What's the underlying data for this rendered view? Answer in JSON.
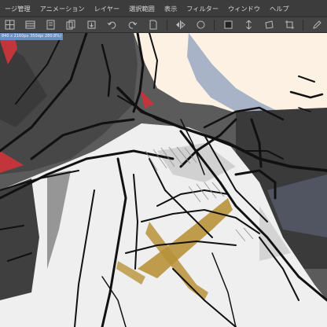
{
  "menubar": {
    "items": [
      {
        "label": "ージ管理",
        "name": "menu-page-management"
      },
      {
        "label": "アニメーション",
        "name": "menu-animation"
      },
      {
        "label": "レイヤー",
        "name": "menu-layer"
      },
      {
        "label": "選択範囲",
        "name": "menu-selection"
      },
      {
        "label": "表示",
        "name": "menu-view"
      },
      {
        "label": "フィルター",
        "name": "menu-filter"
      },
      {
        "label": "ウィンドウ",
        "name": "menu-window"
      },
      {
        "label": "ヘルプ",
        "name": "menu-help"
      }
    ]
  },
  "toolbar": {
    "icons": [
      "grid-icon",
      "table-icon",
      "layer-icon",
      "copy-icon",
      "export-icon",
      "undo-icon",
      "redo-icon",
      "file-icon",
      "flip-icon",
      "circle-icon",
      "fill-icon",
      "arrows-vertical-icon",
      "transform-icon",
      "crop-icon",
      "pen-icon"
    ]
  },
  "document": {
    "tab_label": "840 x 2160px 350dpi 280.8%)"
  },
  "colors": {
    "skin": "#fdf1e4",
    "shadow": "#a9b3c8",
    "hair": "#3f3f3f",
    "accent_red": "#c2363b",
    "gold": "#b8923a",
    "cloth": "#f0f0f0",
    "cloth_shadow": "#c9c9c9"
  }
}
